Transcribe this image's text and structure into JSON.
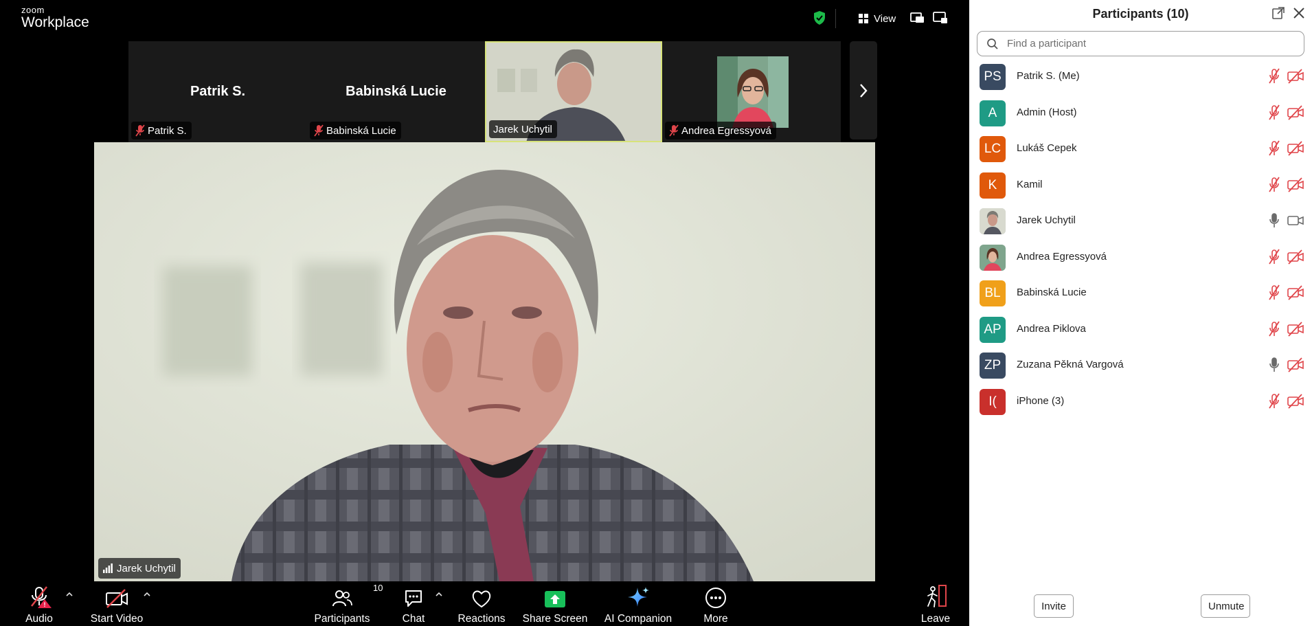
{
  "brand": {
    "small": "zoom",
    "big": "Workplace"
  },
  "topbar": {
    "view_label": "View"
  },
  "strip": {
    "tiles": [
      {
        "big_name": "Patrik S.",
        "label": "Patrik S.",
        "muted": true
      },
      {
        "big_name": "Babinská Lucie",
        "label": "Babinská Lucie",
        "muted": true
      },
      {
        "big_name": "",
        "label": "Jarek Uchytil",
        "muted": false
      },
      {
        "big_name": "",
        "label": "Andrea Egressyová",
        "muted": true
      }
    ]
  },
  "main_video": {
    "label": "Jarek Uchytil"
  },
  "toolbar": {
    "audio": "Audio",
    "start_video": "Start Video",
    "participants": "Participants",
    "participants_count": "10",
    "chat": "Chat",
    "reactions": "Reactions",
    "share_screen": "Share Screen",
    "ai_companion": "AI Companion",
    "more": "More",
    "leave": "Leave"
  },
  "panel": {
    "title": "Participants (10)",
    "search_placeholder": "Find a participant",
    "invite": "Invite",
    "unmute": "Unmute",
    "participants": [
      {
        "initials": "PS",
        "name": "Patrik S. (Me)",
        "color": "#394a61",
        "mic": "muted",
        "video": "off"
      },
      {
        "initials": "A",
        "name": "Admin (Host)",
        "color": "#1f9b85",
        "mic": "muted",
        "video": "off"
      },
      {
        "initials": "LC",
        "name": "Lukáš Cepek",
        "color": "#e0590b",
        "mic": "muted",
        "video": "off"
      },
      {
        "initials": "K",
        "name": "Kamil",
        "color": "#e0590b",
        "mic": "muted",
        "video": "off"
      },
      {
        "initials": "",
        "name": "Jarek Uchytil",
        "color": "#c9c9c9",
        "mic": "on",
        "video": "on"
      },
      {
        "initials": "",
        "name": "Andrea Egressyová",
        "color": "#c9c9c9",
        "mic": "muted",
        "video": "off"
      },
      {
        "initials": "BL",
        "name": "Babinská Lucie",
        "color": "#f0a01a",
        "mic": "muted",
        "video": "off"
      },
      {
        "initials": "AP",
        "name": "Andrea Piklova",
        "color": "#1f9b85",
        "mic": "muted",
        "video": "off"
      },
      {
        "initials": "ZP",
        "name": "Zuzana Pěkná Vargová",
        "color": "#394a61",
        "mic": "on",
        "video": "off"
      },
      {
        "initials": "I(",
        "name": "iPhone (3)",
        "color": "#c9302c",
        "mic": "muted",
        "video": "off"
      }
    ]
  },
  "colors": {
    "muted_red": "#e0454a",
    "share_green": "#18c05a",
    "secure_green": "#1dbb4a",
    "active_tile_border": "#d7e37a"
  }
}
